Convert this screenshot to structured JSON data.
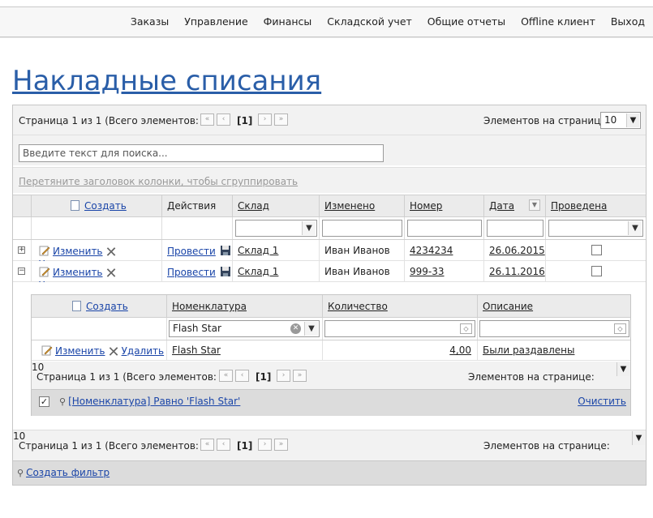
{
  "menu": [
    "Заказы",
    "Управление",
    "Финансы",
    "Складской учет",
    "Общие отчеты",
    "Offline клиент",
    "Выход"
  ],
  "page_title": "Накладные списания",
  "pager": {
    "info": "Страница 1 из 1 (Всего элементов: 2)",
    "page": "[1]",
    "page_size_label": "Элементов на странице:",
    "page_size": "10"
  },
  "search": {
    "placeholder": "Введите текст для поиска..."
  },
  "group_hint": "Перетяните заголовок колонки, чтобы сгруппировать",
  "columns": {
    "create": "Создать",
    "actions": "Действия",
    "warehouse": "Склад",
    "modified": "Изменено",
    "number": "Номер",
    "date": "Дата",
    "posted": "Проведена"
  },
  "row_actions": {
    "edit": "Изменить",
    "delete": "Удалить",
    "post": "Провести"
  },
  "rows": [
    {
      "warehouse": "Склад 1",
      "modified": "Иван Иванов",
      "number": "4234234",
      "date": "26.06.2015",
      "posted": false
    },
    {
      "warehouse": "Склад 1",
      "modified": "Иван Иванов",
      "number": "999-33",
      "date": "26.11.2016",
      "posted": false
    }
  ],
  "detail": {
    "columns": {
      "create": "Создать",
      "nomenclature": "Номенклатура",
      "quantity": "Количество",
      "description": "Описание"
    },
    "filter_value": "Flash Star",
    "row": {
      "nomenclature": "Flash Star",
      "quantity": "4,00",
      "description": "Были раздавлены"
    },
    "pager_info": "Страница 1 из 1 (Всего элементов: 1)",
    "page": "[1]",
    "page_size_label": "Элементов на странице:",
    "page_size": "10",
    "active_filter": "[Номенклатура] Равно 'Flash Star'",
    "clear_label": "Очистить"
  },
  "create_filter": "Создать фильтр",
  "colors": {
    "title": "#2a5ea8",
    "link": "#1a45a8",
    "header_bg": "#ebebeb",
    "pager_bg": "#f2f2f2"
  }
}
